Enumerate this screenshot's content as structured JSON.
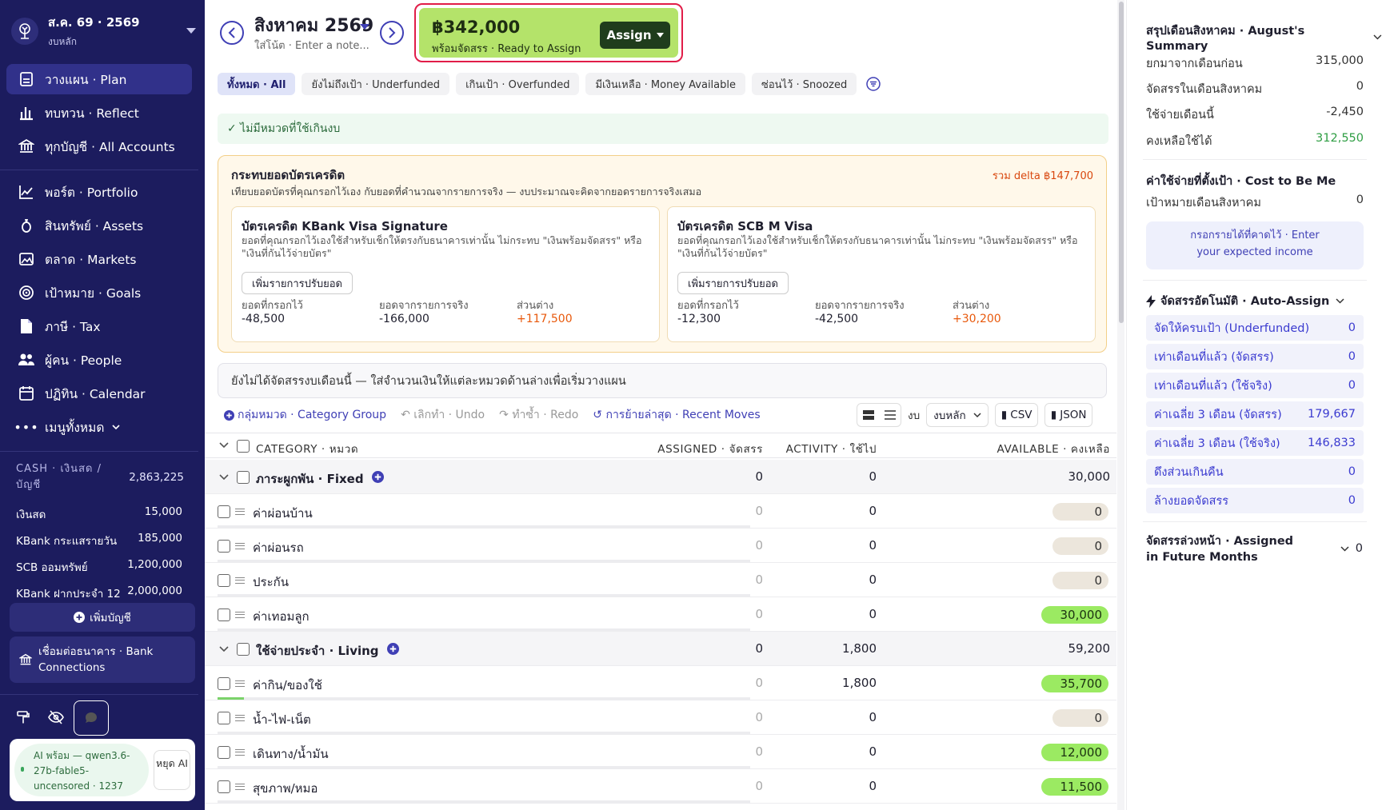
{
  "sidebar": {
    "budget_title": "ส.ค. 69 · 2569",
    "budget_sub": "งบหลัก",
    "nav": [
      {
        "label": "วางแผน · Plan",
        "icon": "plan-icon"
      },
      {
        "label": "ทบทวน · Reflect",
        "icon": "chart-bars-icon"
      },
      {
        "label": "ทุกบัญชี · All Accounts",
        "icon": "bank-icon"
      },
      {
        "label": "พอร์ต · Portfolio",
        "icon": "line-chart-icon"
      },
      {
        "label": "สินทรัพย์ · Assets",
        "icon": "coin-icon"
      },
      {
        "label": "ตลาด · Markets",
        "icon": "image-chart-icon"
      },
      {
        "label": "เป้าหมาย · Goals",
        "icon": "target-icon"
      },
      {
        "label": "ภาษี · Tax",
        "icon": "document-icon"
      },
      {
        "label": "ผู้คน · People",
        "icon": "people-icon"
      },
      {
        "label": "ปฏิทิน · Calendar",
        "icon": "calendar-icon"
      },
      {
        "label": "เมนูทั้งหมด",
        "icon": "more-icon"
      }
    ],
    "cash_label": "CASH · เงินสด / บัญชี",
    "cash_total": "2,863,225",
    "accounts": [
      {
        "name": "เงินสด",
        "amount": "15,000"
      },
      {
        "name": "KBank กระแสรายวัน",
        "amount": "185,000"
      },
      {
        "name": "SCB ออมทรัพย์",
        "amount": "1,200,000"
      },
      {
        "name": "KBank ฝากประจำ 12 เ...",
        "amount": "2,000,000"
      }
    ],
    "add_account": "เพิ่มบัญชี",
    "bank_connections": "เชื่อมต่อธนาคาร · Bank Connections",
    "ai_status": "AI พร้อม — qwen3.6-27b-fable5-uncensored · 1237",
    "ai_stop": "หยุด AI"
  },
  "header": {
    "month": "สิงหาคม 2569",
    "note_placeholder": "ใส่โน้ต · Enter a note...",
    "ready_amount": "฿342,000",
    "ready_label": "พร้อมจัดสรร · Ready to Assign",
    "assign_btn": "Assign"
  },
  "filters": [
    "ทั้งหมด · All",
    "ยังไม่ถึงเป้า · Underfunded",
    "เกินเป้า · Overfunded",
    "มีเงินเหลือ · Money Available",
    "ซ่อนไว้ · Snoozed"
  ],
  "ok_message": "✓ ไม่มีหมวดที่ใช้เกินงบ",
  "credit_impact": {
    "title": "กระทบยอดบัตรเครดิต",
    "desc": "เทียบยอดบัตรที่คุณกรอกไว้เอง กับยอดที่คำนวณจากรายการจริง — งบประมาณจะคิดจากยอดรายการจริงเสมอ",
    "total": "รวม delta ฿147,700",
    "cards": [
      {
        "name": "บัตรเครดิต KBank Visa Signature",
        "desc": "ยอดที่คุณกรอกไว้เองใช้สำหรับเช็กให้ตรงกับธนาคารเท่านั้น ไม่กระทบ \"เงินพร้อมจัดสรร\" หรือ \"เงินที่กันไว้จ่ายบัตร\"",
        "btn": "เพิ่มรายการปรับยอด",
        "entered_label": "ยอดที่กรอกไว้",
        "entered": "-48,500",
        "actual_label": "ยอดจากรายการจริง",
        "actual": "-166,000",
        "diff_label": "ส่วนต่าง",
        "diff": "+117,500"
      },
      {
        "name": "บัตรเครดิต SCB M Visa",
        "desc": "ยอดที่คุณกรอกไว้เองใช้สำหรับเช็กให้ตรงกับธนาคารเท่านั้น ไม่กระทบ \"เงินพร้อมจัดสรร\" หรือ \"เงินที่กันไว้จ่ายบัตร\"",
        "btn": "เพิ่มรายการปรับยอด",
        "entered_label": "ยอดที่กรอกไว้",
        "entered": "-12,300",
        "actual_label": "ยอดจากรายการจริง",
        "actual": "-42,500",
        "diff_label": "ส่วนต่าง",
        "diff": "+30,200"
      }
    ]
  },
  "notice": "ยังไม่ได้จัดสรรงบเดือนนี้ — ใส่จำนวนเงินให้แต่ละหมวดด้านล่างเพื่อเริ่มวางแผน",
  "toolbar": {
    "category_group": "กลุ่มหมวด · Category Group",
    "undo": "เลิกทำ · Undo",
    "redo": "ทำซ้ำ · Redo",
    "recent": "การย้ายล่าสุด · Recent Moves",
    "budget_label": "งบ",
    "budget_select": "งบหลัก",
    "csv": "CSV",
    "json": "JSON"
  },
  "table": {
    "headers": {
      "category": "CATEGORY · หมวด",
      "assigned": "ASSIGNED · จัดสรร",
      "activity": "ACTIVITY · ใช้ไป",
      "available": "AVAILABLE · คงเหลือ"
    },
    "rows": [
      {
        "type": "group",
        "name": "ภาระผูกพัน · Fixed",
        "assigned": "0",
        "activity": "0",
        "available": "30,000"
      },
      {
        "type": "item",
        "name": "ค่าผ่อนบ้าน",
        "assigned": "0",
        "activity": "0",
        "available": "0",
        "pill": "zero",
        "progress": 0
      },
      {
        "type": "item",
        "name": "ค่าผ่อนรถ",
        "assigned": "0",
        "activity": "0",
        "available": "0",
        "pill": "zero",
        "progress": 0
      },
      {
        "type": "item",
        "name": "ประกัน",
        "assigned": "0",
        "activity": "0",
        "available": "0",
        "pill": "zero",
        "progress": 0
      },
      {
        "type": "item",
        "name": "ค่าเทอมลูก",
        "assigned": "0",
        "activity": "0",
        "available": "30,000",
        "pill": "pos",
        "progress": 0
      },
      {
        "type": "group",
        "name": "ใช้จ่ายประจำ · Living",
        "assigned": "0",
        "activity": "1,800",
        "available": "59,200"
      },
      {
        "type": "item",
        "name": "ค่ากิน/ของใช้",
        "assigned": "0",
        "activity": "1,800",
        "available": "35,700",
        "pill": "pos",
        "progress": 0.05
      },
      {
        "type": "item",
        "name": "น้ำ-ไฟ-เน็ต",
        "assigned": "0",
        "activity": "0",
        "available": "0",
        "pill": "zero",
        "progress": 0
      },
      {
        "type": "item",
        "name": "เดินทาง/น้ำมัน",
        "assigned": "0",
        "activity": "0",
        "available": "12,000",
        "pill": "pos",
        "progress": 0
      },
      {
        "type": "item",
        "name": "สุขภาพ/หมอ",
        "assigned": "0",
        "activity": "0",
        "available": "11,500",
        "pill": "pos",
        "progress": 0
      }
    ]
  },
  "summary": {
    "title": "สรุปเดือนสิงหาคม · August's Summary",
    "rows": [
      {
        "label": "ยกมาจากเดือนก่อน",
        "value": "315,000"
      },
      {
        "label": "จัดสรรในเดือนสิงหาคม",
        "value": "0"
      },
      {
        "label": "ใช้จ่ายเดือนนี้",
        "value": "-2,450"
      },
      {
        "label": "คงเหลือใช้ได้",
        "value": "312,550"
      }
    ],
    "cost_title": "ค่าใช้จ่ายที่ตั้งเป้า · Cost to Be Me",
    "cost_label": "เป้าหมายเดือนสิงหาคม",
    "cost_value": "0",
    "income_btn": "กรอกรายได้ที่คาดไว้ · Enter your expected income",
    "auto_title": "จัดสรรอัตโนมัติ · Auto-Assign",
    "auto": [
      {
        "label": "จัดให้ครบเป้า (Underfunded)",
        "value": "0"
      },
      {
        "label": "เท่าเดือนที่แล้ว (จัดสรร)",
        "value": "0"
      },
      {
        "label": "เท่าเดือนที่แล้ว (ใช้จริง)",
        "value": "0"
      },
      {
        "label": "ค่าเฉลี่ย 3 เดือน (จัดสรร)",
        "value": "179,667"
      },
      {
        "label": "ค่าเฉลี่ย 3 เดือน (ใช้จริง)",
        "value": "146,833"
      },
      {
        "label": "ดึงส่วนเกินคืน",
        "value": "0"
      },
      {
        "label": "ล้างยอดจัดสรร",
        "value": "0"
      }
    ],
    "future_title": "จัดสรรล่วงหน้า · Assigned in Future Months",
    "future_value": "0"
  },
  "colors": {
    "sidebar": "#1c1c5e",
    "accent": "#3f3fb5",
    "ready": "#b4e36a",
    "positive_pill": "#9bea62",
    "highlight": "#e11d48"
  }
}
